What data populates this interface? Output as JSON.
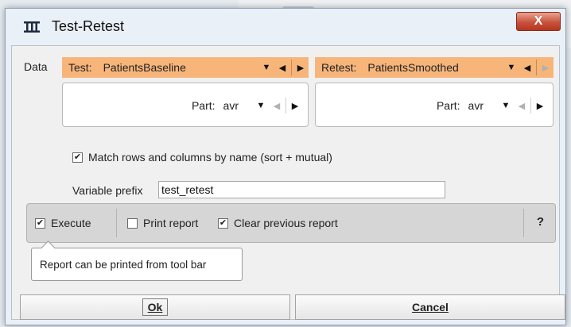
{
  "dialog": {
    "title": "Test-Retest",
    "close_label": "X"
  },
  "data_label": "Data",
  "test": {
    "label": "Test:",
    "value": "PatientsBaseline",
    "part_label": "Part:",
    "part_value": "avr"
  },
  "retest": {
    "label": "Retest:",
    "value": "PatientsSmoothed",
    "part_label": "Part:",
    "part_value": "avr"
  },
  "options": {
    "match_label": "Match rows and columns by name (sort + mutual)",
    "match_checked": true,
    "prefix_label": "Variable prefix",
    "prefix_value": "test_retest"
  },
  "exec_bar": {
    "execute_label": "Execute",
    "execute_checked": true,
    "print_label": "Print report",
    "print_checked": false,
    "clear_label": "Clear previous report",
    "clear_checked": true,
    "help_label": "?"
  },
  "tooltip": "Report can be printed from tool bar",
  "buttons": {
    "ok": "Ok",
    "cancel": "Cancel"
  },
  "colors": {
    "selector_bg": "#f7b57a",
    "close_button": "#c8523c"
  }
}
